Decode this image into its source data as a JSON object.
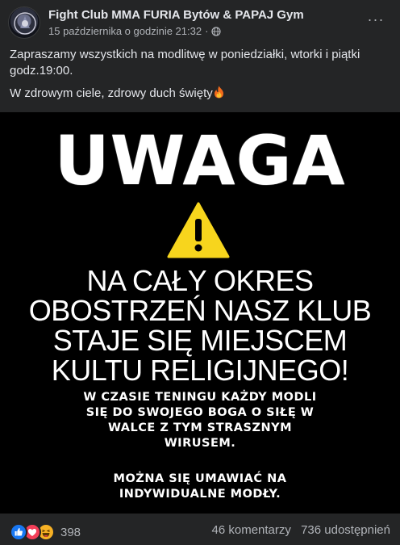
{
  "post": {
    "page_name": "Fight Club MMA FURIA Bytów & PAPAJ Gym",
    "date": "15 października o godzinie 21:32",
    "separator": "·",
    "more_label": "···",
    "text_line1": "Zapraszamy wszystkich na modlitwę w poniedziałki, wtorki i piątki godz.19:00.",
    "text_line2": "W zdrowym ciele, zdrowy duch święty",
    "emoji_icon": "fire-emoji"
  },
  "image": {
    "headline": "UWAGA",
    "warning_icon": "warning-triangle-icon",
    "main_lines": [
      "NA CAŁY OKRES",
      "OBOSTRZEŃ NASZ KLUB",
      "STAJE SIĘ MIEJSCEM",
      "KULTU RELIGIJNEGO!"
    ],
    "sub_lines": [
      "W CZASIE TENINGU KAŻDY MODLI",
      "SIĘ DO SWOJEGO BOGA O SIŁĘ W",
      "WALCE Z TYM STRASZNYM",
      "WIRUSEM."
    ],
    "sub2_lines": [
      "MOŻNA SIĘ UMAWIAĆ NA",
      "INDYWIDUALNE MODŁY."
    ],
    "colors": {
      "background": "#000000",
      "text": "#ffffff",
      "warning_fill": "#f7d51d"
    }
  },
  "footer": {
    "reaction_icons": [
      "like-icon",
      "love-icon",
      "haha-icon"
    ],
    "reaction_count": "398",
    "comments": "46 komentarzy",
    "shares": "736 udostępnień"
  },
  "theme": {
    "surface": "#242526",
    "text_primary": "#e4e6eb",
    "text_secondary": "#b0b3b8",
    "like_blue": "#1877f2",
    "love_red": "#f33e58",
    "haha_yellow": "#f7b125"
  }
}
